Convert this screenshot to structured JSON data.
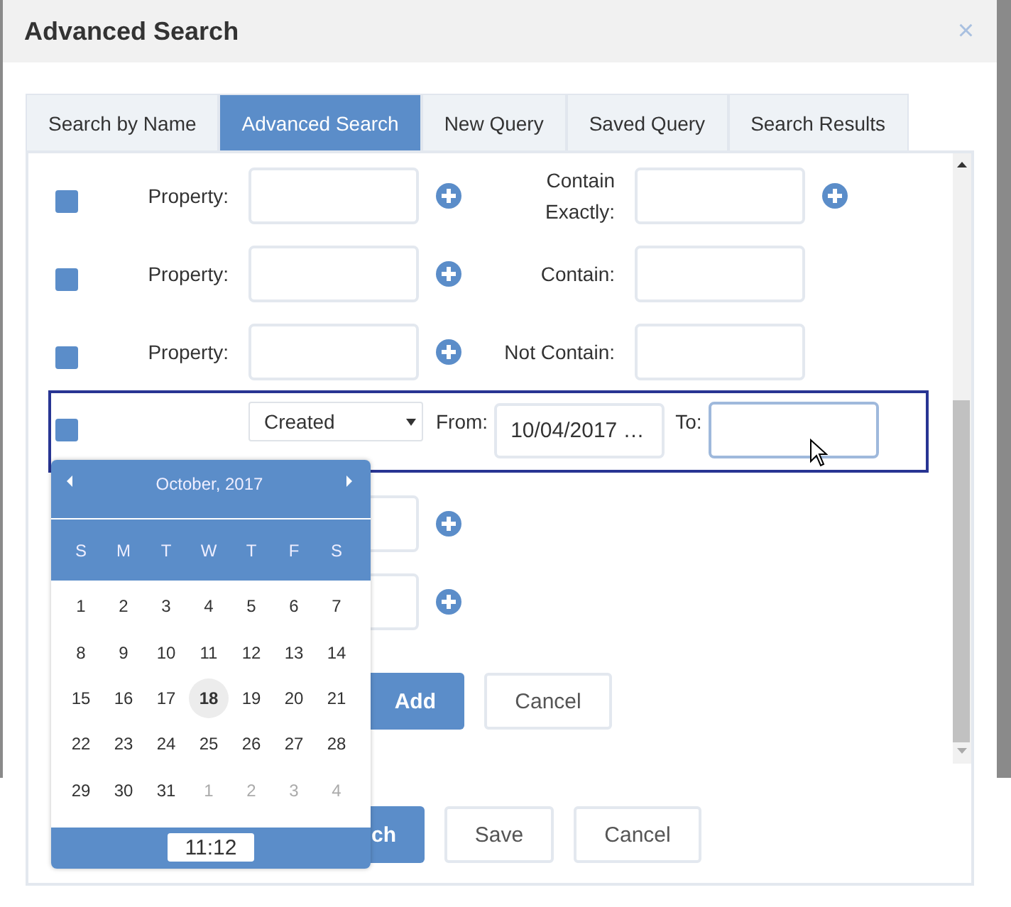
{
  "dialog": {
    "title": "Advanced Search",
    "close": "×"
  },
  "tabs": [
    {
      "label": "Search by Name",
      "selected": false
    },
    {
      "label": "Advanced Search",
      "selected": true
    },
    {
      "label": "New Query",
      "selected": false
    },
    {
      "label": "Saved Query",
      "selected": false
    },
    {
      "label": "Search Results",
      "selected": false
    }
  ],
  "criteria": [
    {
      "kind": "text",
      "checked": true,
      "label": "Property:",
      "match_label": "Contain Exactly:",
      "second_add": true
    },
    {
      "kind": "text",
      "checked": true,
      "label": "Property:",
      "match_label": "Contain:",
      "second_add": false
    },
    {
      "kind": "text",
      "checked": true,
      "label": "Property:",
      "match_label": "Not Contain:",
      "second_add": false
    },
    {
      "kind": "date",
      "checked": true,
      "field": "Created",
      "from_label": "From:",
      "from_value": "10/04/2017 …",
      "to_label": "To:"
    },
    {
      "kind": "covered"
    },
    {
      "kind": "covered"
    }
  ],
  "row_buttons": [
    {
      "label": "Add",
      "kind": "primary"
    },
    {
      "label": "Cancel",
      "kind": "default"
    }
  ],
  "footer_buttons": [
    {
      "label": "ch",
      "kind": "primary"
    },
    {
      "label": "Save",
      "kind": "default"
    },
    {
      "label": "Cancel",
      "kind": "default"
    }
  ],
  "calendar": {
    "month": "October, 2017",
    "weekdays": [
      "S",
      "M",
      "T",
      "W",
      "T",
      "F",
      "S"
    ],
    "weeks": [
      [
        {
          "day": "1",
          "other_month": false,
          "selected": false
        },
        {
          "day": "2",
          "other_month": false,
          "selected": false
        },
        {
          "day": "3",
          "other_month": false,
          "selected": false
        },
        {
          "day": "4",
          "other_month": false,
          "selected": false
        },
        {
          "day": "5",
          "other_month": false,
          "selected": false
        },
        {
          "day": "6",
          "other_month": false,
          "selected": false
        },
        {
          "day": "7",
          "other_month": false,
          "selected": false
        }
      ],
      [
        {
          "day": "8",
          "other_month": false,
          "selected": false
        },
        {
          "day": "9",
          "other_month": false,
          "selected": false
        },
        {
          "day": "10",
          "other_month": false,
          "selected": false
        },
        {
          "day": "11",
          "other_month": false,
          "selected": false
        },
        {
          "day": "12",
          "other_month": false,
          "selected": false
        },
        {
          "day": "13",
          "other_month": false,
          "selected": false
        },
        {
          "day": "14",
          "other_month": false,
          "selected": false
        }
      ],
      [
        {
          "day": "15",
          "other_month": false,
          "selected": false
        },
        {
          "day": "16",
          "other_month": false,
          "selected": false
        },
        {
          "day": "17",
          "other_month": false,
          "selected": false
        },
        {
          "day": "18",
          "other_month": false,
          "selected": true
        },
        {
          "day": "19",
          "other_month": false,
          "selected": false
        },
        {
          "day": "20",
          "other_month": false,
          "selected": false
        },
        {
          "day": "21",
          "other_month": false,
          "selected": false
        }
      ],
      [
        {
          "day": "22",
          "other_month": false,
          "selected": false
        },
        {
          "day": "23",
          "other_month": false,
          "selected": false
        },
        {
          "day": "24",
          "other_month": false,
          "selected": false
        },
        {
          "day": "25",
          "other_month": false,
          "selected": false
        },
        {
          "day": "26",
          "other_month": false,
          "selected": false
        },
        {
          "day": "27",
          "other_month": false,
          "selected": false
        },
        {
          "day": "28",
          "other_month": false,
          "selected": false
        }
      ],
      [
        {
          "day": "29",
          "other_month": false,
          "selected": false
        },
        {
          "day": "30",
          "other_month": false,
          "selected": false
        },
        {
          "day": "31",
          "other_month": false,
          "selected": false
        },
        {
          "day": "1",
          "other_month": true,
          "selected": false
        },
        {
          "day": "2",
          "other_month": true,
          "selected": false
        },
        {
          "day": "3",
          "other_month": true,
          "selected": false
        },
        {
          "day": "4",
          "other_month": true,
          "selected": false
        }
      ]
    ],
    "time": "11:12"
  }
}
